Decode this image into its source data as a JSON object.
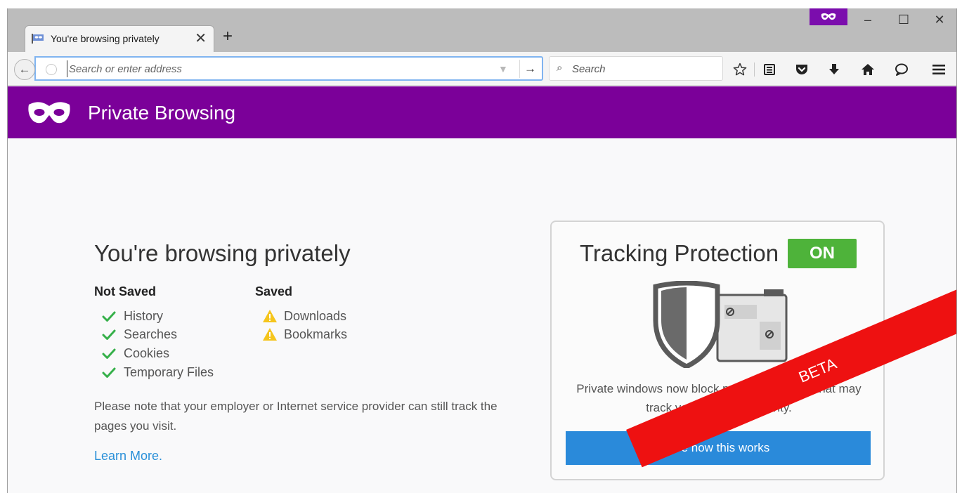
{
  "tab": {
    "title": "You're browsing privately",
    "close_symbol": "✕",
    "icon": "private-flag-icon"
  },
  "tabbar": {
    "new_tab_symbol": "+"
  },
  "window_controls": {
    "minimize": "–",
    "maximize": "☐",
    "close": "✕"
  },
  "navbar": {
    "address_placeholder": "Search or enter address",
    "address_value": "",
    "go_symbol": "→",
    "search_placeholder": "Search"
  },
  "header": {
    "title": "Private Browsing"
  },
  "main": {
    "title": "You're browsing privately",
    "not_saved_heading": "Not Saved",
    "not_saved_items": [
      "History",
      "Searches",
      "Cookies",
      "Temporary Files"
    ],
    "saved_heading": "Saved",
    "saved_items": [
      "Downloads",
      "Bookmarks"
    ],
    "note": "Please note that your employer or Internet service provider can still track the pages you visit.",
    "learn_more": "Learn More."
  },
  "tracking": {
    "title": "Tracking Protection",
    "status": "ON",
    "description": "Private windows now block parts of the page that may track your browsing activity.",
    "button": "See how this works"
  },
  "ribbon": {
    "label": "BETA"
  },
  "colors": {
    "private_purple": "#7b0099",
    "on_green": "#4eb33a",
    "button_blue": "#2a8ada",
    "link_blue": "#2a90d8",
    "ribbon_red": "#ee1111"
  }
}
